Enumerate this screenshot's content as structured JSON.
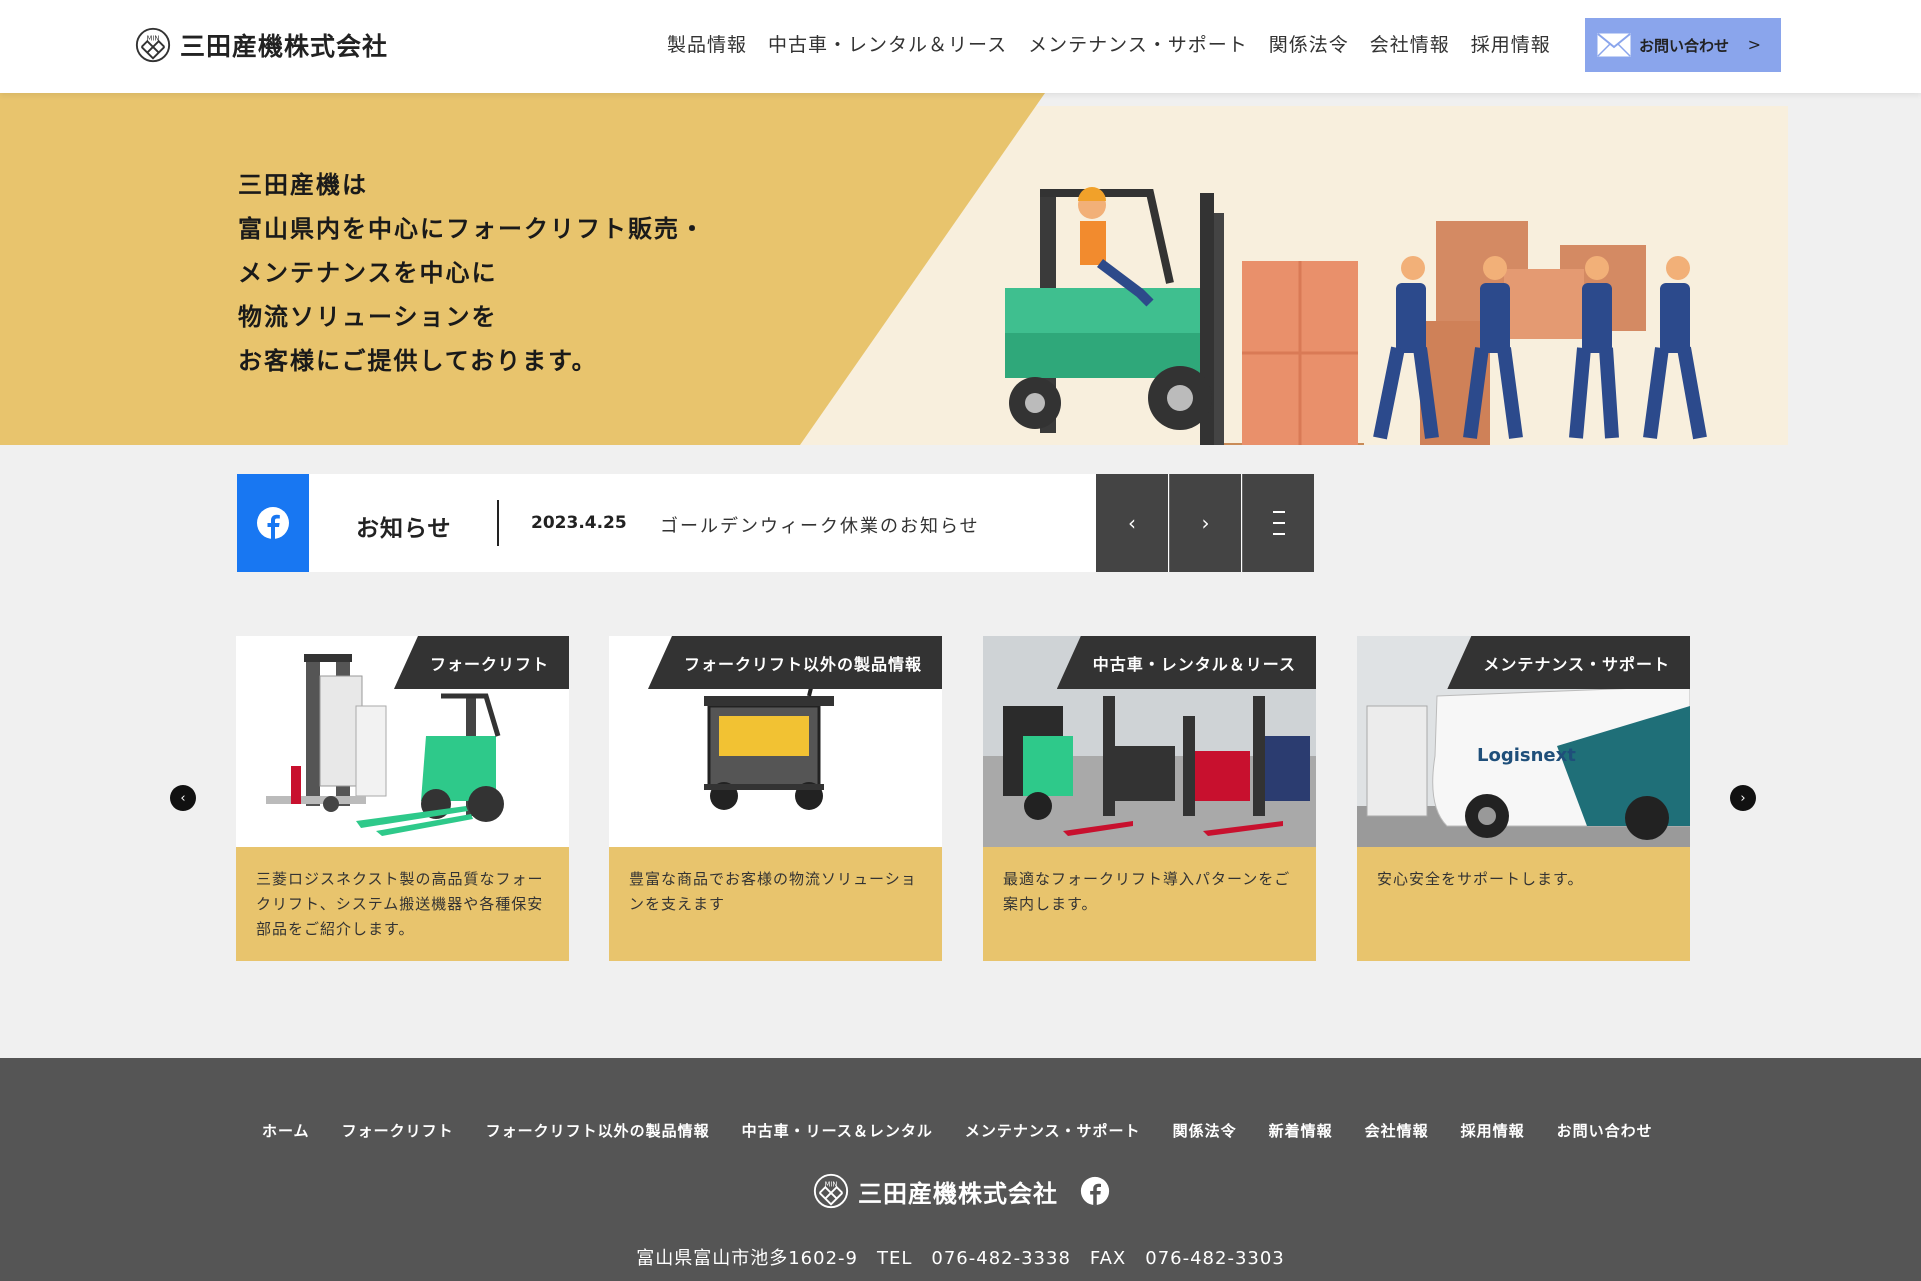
{
  "header": {
    "company_name": "三田産機株式会社",
    "nav": [
      "製品情報",
      "中古車・レンタル＆リース",
      "メンテナンス・サポート",
      "関係法令",
      "会社情報",
      "採用情報"
    ],
    "contact_label": "お問い合わせ",
    "contact_icon": "mail-icon",
    "accent_color": "#8aa5ec"
  },
  "hero": {
    "lines": [
      "三田産機は",
      "富山県内を中心にフォークリフト販売・",
      "メンテナンスを中心に",
      "物流ソリューションを",
      "お客様にご提供しております。"
    ],
    "gold_color": "#e8c46d"
  },
  "news": {
    "icon": "facebook-icon",
    "title": "お知らせ",
    "date": "2023.4.25",
    "text": "ゴールデンウィーク休業のお知らせ",
    "prev": "‹",
    "next": "›"
  },
  "cards": [
    {
      "tag": "フォークリフト",
      "body": "三菱ロジスネクスト製の高品質なフォークリフト、システム搬送機器や各種保安部品をご紹介します。"
    },
    {
      "tag": "フォークリフト以外の製品情報",
      "body": "豊富な商品でお客様の物流ソリューションを支えます"
    },
    {
      "tag": "中古車・レンタル＆リース",
      "body": "最適なフォークリフト導入パターンをご案内します。"
    },
    {
      "tag": "メンテナンス・サポート",
      "body": "安心安全をサポートします。"
    }
  ],
  "carousel": {
    "prev": "‹",
    "next": "›"
  },
  "footer": {
    "nav": [
      "ホーム",
      "フォークリフト",
      "フォークリフト以外の製品情報",
      "中古車・リース＆レンタル",
      "メンテナンス・サポート",
      "関係法令",
      "新着情報",
      "会社情報",
      "採用情報",
      "お問い合わせ"
    ],
    "company_name": "三田産機株式会社",
    "address": "富山県富山市池多1602-9　TEL　076-482-3338　FAX　076-482-3303"
  }
}
